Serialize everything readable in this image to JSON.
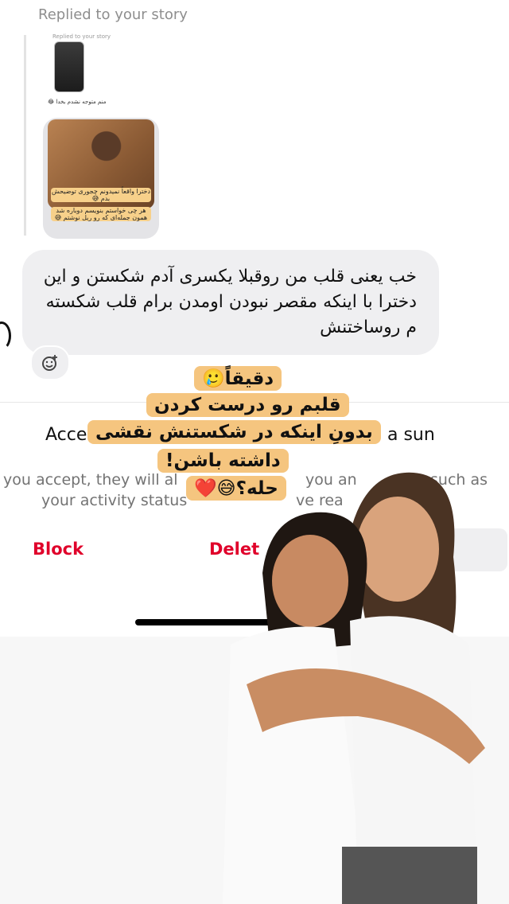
{
  "reply": {
    "label": "Replied to your story",
    "story_mini_label": "Replied to your story",
    "story_mini_text": "منم متوجه نشدم بخدا 😂",
    "caption_1": "دخترا واقعاً نمیدونم چجوری توضیحش بدم 😅",
    "caption_2": "هر چی خواستم بنویسم دوباره شد همون جمله‌ای که رو ریل نوشتم 😅"
  },
  "message": {
    "text": "خب یعنی قلب من روقبلا یکسری آدم شکستن و این دخترا با اینکه مقصر نبودن اومدن برام قلب شکسته م روساختنش",
    "react_icon": "emoji-add-icon"
  },
  "request": {
    "title_left": "Acce",
    "title_right": "a sun",
    "desc_line1_left": "you accept, they will al",
    "desc_line1_right": "you an",
    "desc_line1_end": "such as",
    "desc_line2_left": "your activity status",
    "desc_line2_right": "ve rea",
    "block_label": "Block",
    "delete_label": "Delet"
  },
  "sticker": {
    "line1": "دقیقاً🥲",
    "line2": "قلبم رو درست کردن",
    "line3": "بدونِ اینکه در شکستنش نقشی",
    "line4": "داشته باشن!",
    "line5": "حله؟😅❤️"
  },
  "colors": {
    "sticker_bg": "#f5c57f",
    "bubble_bg": "#efeff1",
    "danger": "#e0002a"
  }
}
